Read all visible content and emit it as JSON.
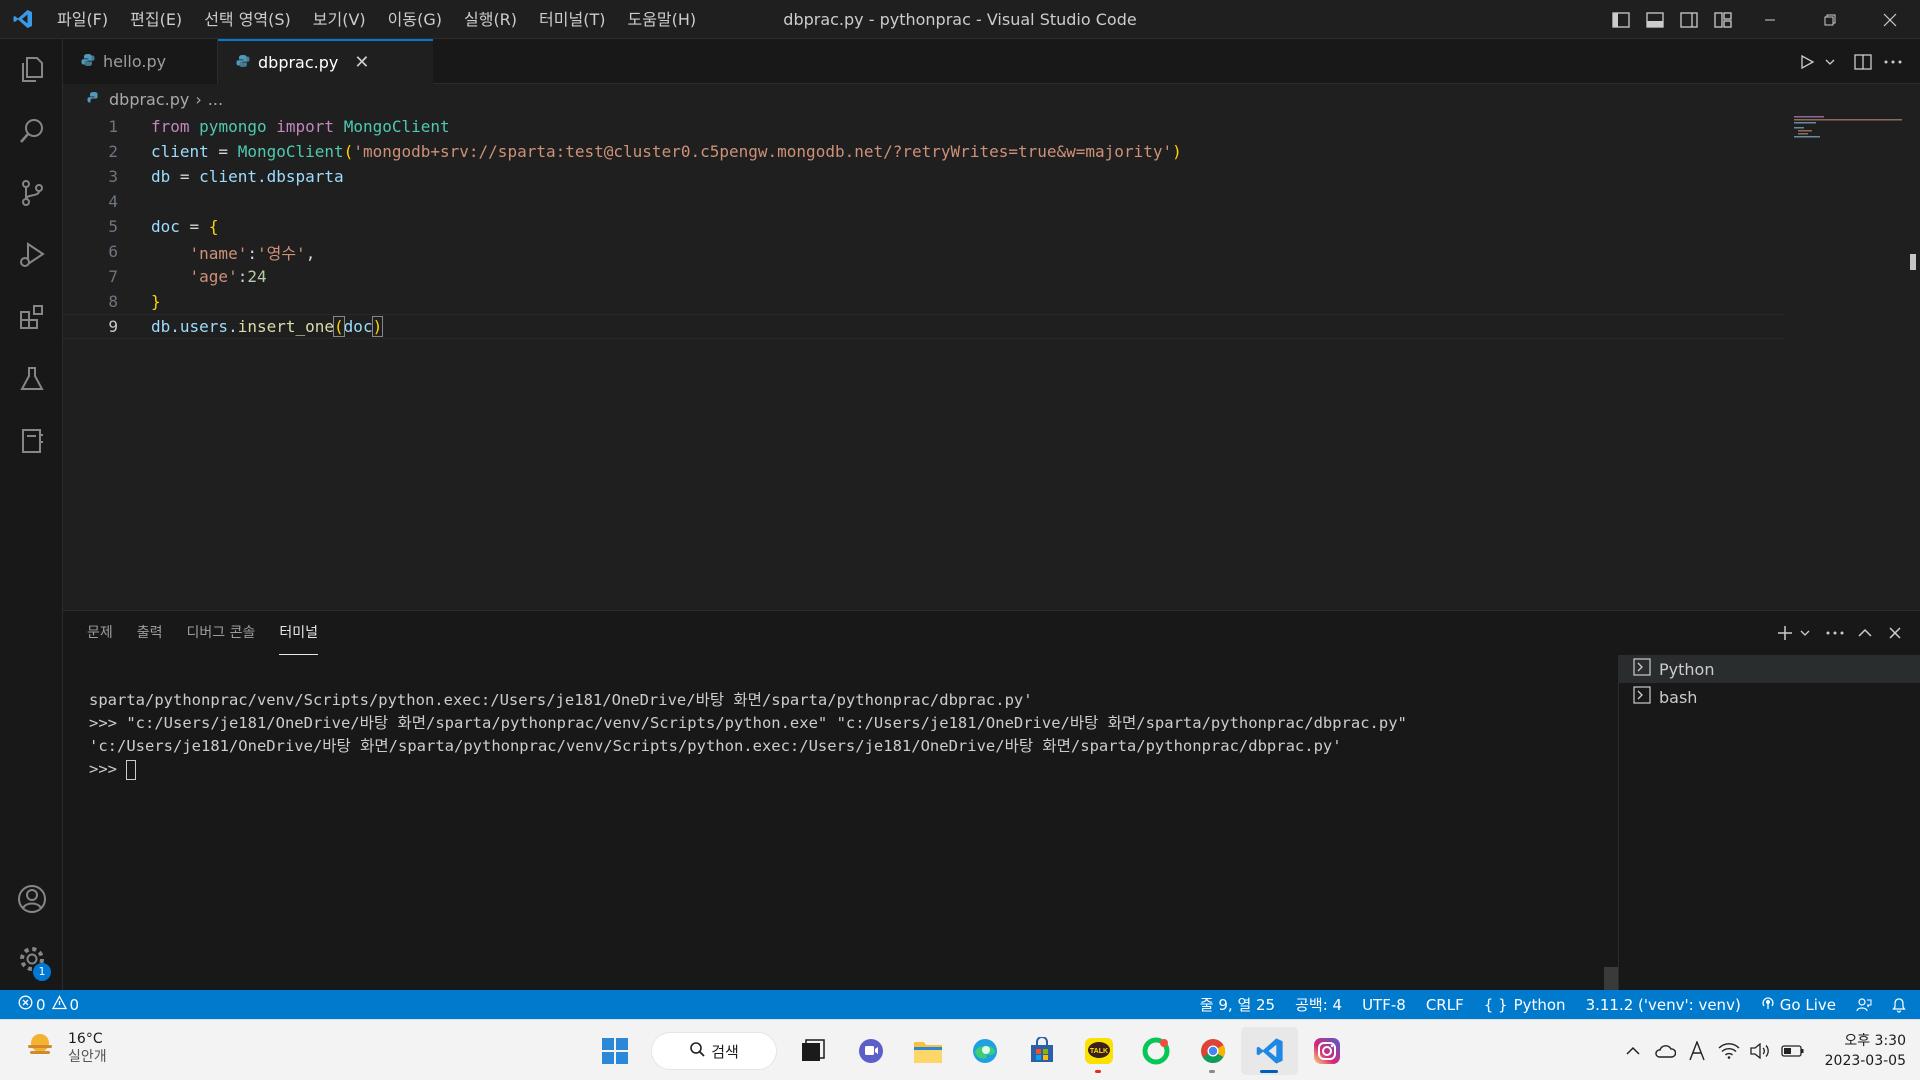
{
  "titlebar": {
    "menu": [
      "파일(F)",
      "편집(E)",
      "선택 영역(S)",
      "보기(V)",
      "이동(G)",
      "실행(R)",
      "터미널(T)",
      "도움말(H)"
    ],
    "title": "dbprac.py - pythonprac - Visual Studio Code"
  },
  "activitybar": {
    "icons": [
      "files-icon",
      "search-icon",
      "source-control-icon",
      "run-debug-icon",
      "extensions-icon",
      "testing-icon",
      "notebook-icon"
    ],
    "bottom_icons": [
      "account-icon",
      "settings-gear-icon"
    ],
    "settings_badge": "1"
  },
  "tabs": [
    {
      "label": "hello.py",
      "active": false
    },
    {
      "label": "dbprac.py",
      "active": true
    }
  ],
  "breadcrumb": {
    "file": "dbprac.py",
    "rest": "..."
  },
  "editor": {
    "line_numbers": [
      "1",
      "2",
      "3",
      "4",
      "5",
      "6",
      "7",
      "8",
      "9"
    ],
    "current_line": 9,
    "lines": {
      "l1": {
        "kw1": "from",
        "mod": "pymongo",
        "kw2": "import",
        "cls": "MongoClient"
      },
      "l2": {
        "var": "client",
        "op": " = ",
        "fn": "MongoClient",
        "open": "(",
        "str": "'mongodb+srv://sparta:test@cluster0.c5pengw.mongodb.net/?retryWrites=true&w=majority'",
        "close": ")"
      },
      "l3": {
        "var": "db",
        "op": " = ",
        "rest": "client.dbsparta"
      },
      "l5": {
        "var": "doc",
        "op": " = ",
        "brace": "{"
      },
      "l6": {
        "key": "'name'",
        "colon": ":",
        "val": "'영수'",
        "comma": ","
      },
      "l7": {
        "key": "'age'",
        "colon": ":",
        "val": "24"
      },
      "l8": {
        "brace": "}"
      },
      "l9": {
        "obj": "db.users.",
        "fn": "insert_one",
        "open": "(",
        "arg": "doc",
        "close": ")"
      }
    }
  },
  "panel": {
    "tabs": [
      "문제",
      "출력",
      "디버그 콘솔",
      "터미널"
    ],
    "active_tab": "터미널",
    "terminal_lines": [
      "sparta/pythonprac/venv/Scripts/python.exec:/Users/je181/OneDrive/바탕 화면/sparta/pythonprac/dbprac.py'",
      ">>> \"c:/Users/je181/OneDrive/바탕 화면/sparta/pythonprac/venv/Scripts/python.exe\" \"c:/Users/je181/OneDrive/바탕 화면/sparta/pythonprac/dbprac.py\"",
      "'c:/Users/je181/OneDrive/바탕 화면/sparta/pythonprac/venv/Scripts/python.exec:/Users/je181/OneDrive/바탕 화면/sparta/pythonprac/dbprac.py'"
    ],
    "prompt": ">>> ",
    "terminals": [
      "Python",
      "bash"
    ]
  },
  "statusbar": {
    "errors": "0",
    "warnings": "0",
    "position": "줄 9, 열 25",
    "spaces": "공백: 4",
    "encoding": "UTF-8",
    "eol": "CRLF",
    "language": "Python",
    "interpreter": "3.11.2 ('venv': venv)",
    "golive": "Go Live"
  },
  "taskbar": {
    "temperature": "16°C",
    "weather": "실안개",
    "search_label": "검색",
    "time": "오후 3:30",
    "date": "2023-03-05"
  },
  "colors": {
    "accent": "#007acc",
    "tab_active_border": "#0078d4"
  }
}
